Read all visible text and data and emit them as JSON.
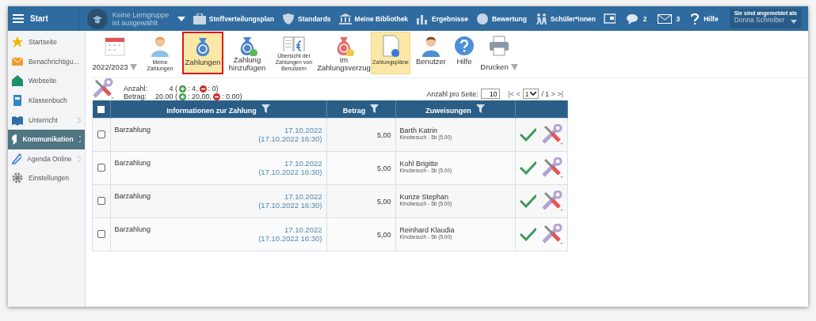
{
  "topbar": {
    "menu_label": "Start",
    "group": "Keine Lerngruppe ist ausgewählt",
    "nav": [
      {
        "label": "Stoffverteilungsplan"
      },
      {
        "label": "Standards"
      },
      {
        "label": "Meine Bibliothek"
      },
      {
        "label": "Ergebnisse"
      },
      {
        "label": "Bewertung"
      },
      {
        "label": "Schüler*innen"
      }
    ],
    "chat_count": "2",
    "mail_count": "3",
    "help": "Hilfe",
    "user": {
      "caption": "Sie sind angemeldet als",
      "name": "Donna Schreiber"
    }
  },
  "sidebar": {
    "items": [
      {
        "label": "Startseite",
        "selected": false,
        "submenu": false
      },
      {
        "label": "Benachrichtigu...",
        "selected": false,
        "submenu": false
      },
      {
        "label": "Webseite",
        "selected": false,
        "submenu": false
      },
      {
        "label": "Klassenbuch",
        "selected": false,
        "submenu": false
      },
      {
        "label": "Unterricht",
        "selected": false,
        "submenu": true
      },
      {
        "label": "Kommunikation",
        "selected": true,
        "submenu": true
      },
      {
        "label": "Agenda Online",
        "selected": false,
        "submenu": true
      },
      {
        "label": "Einstellungen",
        "selected": false,
        "submenu": false
      }
    ]
  },
  "toolbar": [
    {
      "kind": "dropdown",
      "label": "2022/2023",
      "selected": false,
      "highlighted": false
    },
    {
      "kind": "small",
      "label": "Meine Zahlungen",
      "selected": false,
      "highlighted": false
    },
    {
      "kind": "large",
      "label": "Zahlungen",
      "selected": true,
      "highlighted": true
    },
    {
      "kind": "large",
      "label": "Zahlung hinzufügen",
      "selected": false,
      "highlighted": false
    },
    {
      "kind": "small",
      "label": "Übersicht der Zahlungen von Benutzern",
      "selected": false,
      "highlighted": false
    },
    {
      "kind": "large",
      "label": "Im Zahlungsverzug",
      "selected": false,
      "highlighted": false
    },
    {
      "kind": "small",
      "label": "Zahlungspläne",
      "selected": true,
      "highlighted": false
    },
    {
      "kind": "large",
      "label": "Benutzer",
      "selected": false,
      "highlighted": false
    },
    {
      "kind": "large",
      "label": "Hilfe",
      "selected": false,
      "highlighted": false
    },
    {
      "kind": "dropdown",
      "label": "Drucken",
      "selected": false,
      "highlighted": false
    }
  ],
  "summary": {
    "count_label": "Anzahl:",
    "count_total": "4 (",
    "count_plus": ": 4,",
    "count_minus": ": 0)",
    "amount_label": "Betrag:",
    "amount_total": "20.00 (",
    "amount_plus": ": 20,00,",
    "amount_minus": ": 0.00)"
  },
  "pager": {
    "per_page_label": "Anzahl pro Seite:",
    "per_page": "10",
    "first": "|<",
    "prev": "<",
    "page": "1",
    "of": "/ 1",
    "next": ">",
    "last": ">|"
  },
  "table": {
    "all_checked": false,
    "columns": [
      {
        "label": "Informationen zur Zahlung",
        "filter": true
      },
      {
        "label": "Betrag",
        "filter": true
      },
      {
        "label": "Zuweisungen",
        "filter": true
      }
    ],
    "rows": [
      {
        "checked": false,
        "type": "Barzahlung",
        "date": "17.10.2022",
        "datetime": "(17.10.2022 16:30)",
        "amount": "5,00",
        "name": "Barth Katrin",
        "detail": "Kinobesuch - 5b (5.00)"
      },
      {
        "checked": false,
        "type": "Barzahlung",
        "date": "17.10.2022",
        "datetime": "(17.10.2022 16:30)",
        "amount": "5,00",
        "name": "Kohl Brigitte",
        "detail": "Kinobesuch - 5b (5.00)"
      },
      {
        "checked": false,
        "type": "Barzahlung",
        "date": "17.10.2022",
        "datetime": "(17.10.2022 16:30)",
        "amount": "5,00",
        "name": "Kunze Stephan",
        "detail": "Kinobesuch - 5b (5.00)"
      },
      {
        "checked": false,
        "type": "Barzahlung",
        "date": "17.10.2022",
        "datetime": "(17.10.2022 16:30)",
        "amount": "5,00",
        "name": "Reinhard Klaudia",
        "detail": "Kinobesuch - 5b (5.00)"
      }
    ]
  }
}
